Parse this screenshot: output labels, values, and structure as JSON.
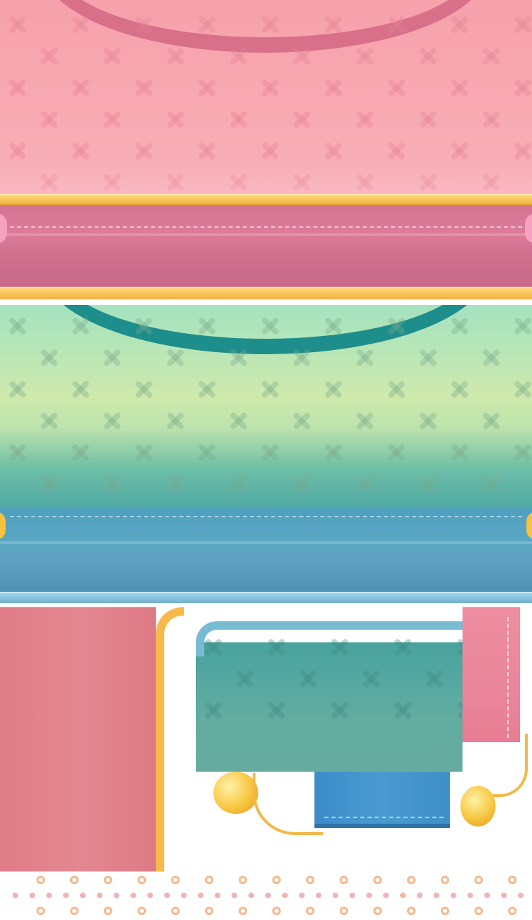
{
  "sprite_sheet": {
    "theme_colors": {
      "pink_panel": "#f8a8b2",
      "pink_band": "#d97595",
      "pink_handle": "#d8708a",
      "gold_trim": "#fbc55a",
      "green_top": "#a6e3c0",
      "green_mid": "#cfe8a8",
      "teal_bottom": "#3e9fa8",
      "teal_handle": "#1e8e8c",
      "blue_band": "#5aa8c6",
      "pink_sidebar": "#e07d86",
      "blue_strap": "#4a98c8",
      "teal_tile": "#5aa89c",
      "pink_strap": "#ea8a9a"
    },
    "pieces": [
      "pink-bag-panel",
      "pink-bag-band",
      "green-bag-panel",
      "blue-bag-band",
      "pink-sidebar",
      "teal-tile",
      "blue-strap",
      "pink-strap",
      "gold-clasp",
      "dot-border-strip"
    ]
  }
}
